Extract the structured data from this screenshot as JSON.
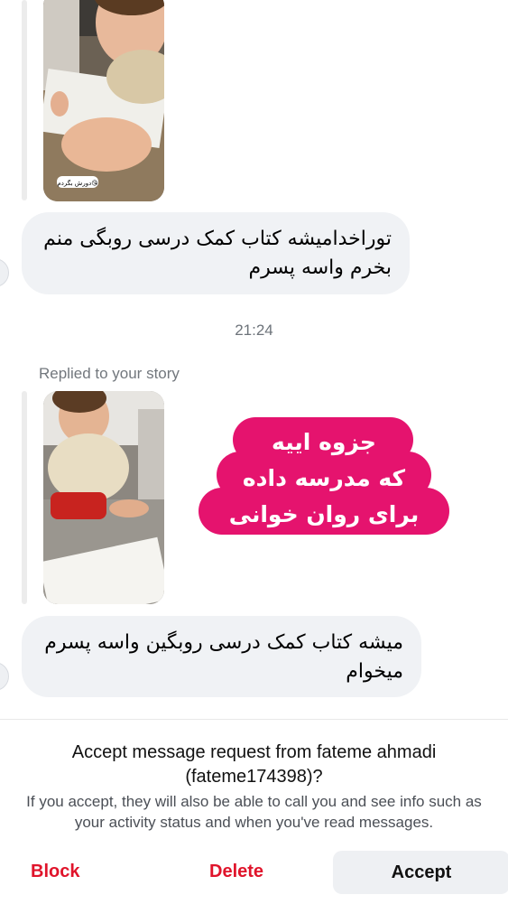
{
  "thread": {
    "story_1": {
      "sticker_text": "دورش بگردم😘"
    },
    "message_1": {
      "line1": "توراخدامیشه کتاب کمک درسی روبگی منم",
      "line2": "بخرم واسه پسرم"
    },
    "timestamp": "21:24",
    "replied_label": "Replied to your story",
    "story_2": {
      "caption_line1": "جزوه اییه",
      "caption_line2": "که مدرسه داده",
      "caption_line3": "برای روان خوانی",
      "caption_color": "#e5136e"
    },
    "message_2": {
      "line1": "میشه کتاب کمک درسی روبگین  واسه پسرم",
      "line2": "میخوام"
    }
  },
  "request": {
    "title_line1": "Accept message request from fateme ahmadi",
    "title_line2": "(fateme174398)?",
    "desc_line1": "If you accept, they will also be able to call you and see info such as",
    "desc_line2": "your activity status and when you've read messages.",
    "block_label": "Block",
    "delete_label": "Delete",
    "accept_label": "Accept",
    "danger_color": "#e0142b"
  }
}
